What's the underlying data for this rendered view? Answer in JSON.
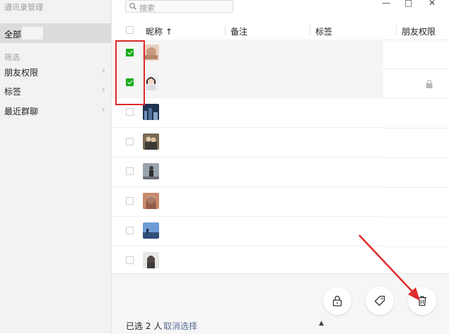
{
  "app": {
    "title": "通讯录管理"
  },
  "sidebar": {
    "all_label": "全部",
    "filter_label": "筛选",
    "items": [
      {
        "label": "朋友权限"
      },
      {
        "label": "标签"
      },
      {
        "label": "最近群聊"
      }
    ]
  },
  "search": {
    "placeholder": "搜索"
  },
  "table": {
    "columns": [
      {
        "label": "昵称 ↑"
      },
      {
        "label": "备注"
      },
      {
        "label": "标签"
      },
      {
        "label": "朋友权限"
      }
    ],
    "rows": [
      {
        "checked": true,
        "avatar": "avatar-food",
        "name": "",
        "remark": "",
        "tag": "",
        "permission": ""
      },
      {
        "checked": true,
        "avatar": "avatar-woman",
        "name": "",
        "remark": "",
        "tag": "",
        "permission": "lock"
      },
      {
        "checked": false,
        "avatar": "avatar-night-city",
        "name": "",
        "remark": "",
        "tag": "",
        "permission": ""
      },
      {
        "checked": false,
        "avatar": "avatar-couple",
        "name": "",
        "remark": "",
        "tag": "",
        "permission": ""
      },
      {
        "checked": false,
        "avatar": "avatar-street",
        "name": "",
        "remark": "",
        "tag": "",
        "permission": ""
      },
      {
        "checked": false,
        "avatar": "avatar-portrait",
        "name": "",
        "remark": "",
        "tag": "",
        "permission": ""
      },
      {
        "checked": false,
        "avatar": "avatar-sky",
        "name": "",
        "remark": "",
        "tag": "",
        "permission": ""
      },
      {
        "checked": false,
        "avatar": "avatar-girl",
        "name": "",
        "remark": "",
        "tag": "",
        "permission": ""
      }
    ]
  },
  "footer": {
    "selected_prefix": "已选",
    "selected_count": "2",
    "selected_suffix": "人",
    "cancel_label": "取消选择",
    "buttons": [
      {
        "icon": "lock-icon"
      },
      {
        "icon": "tag-icon"
      },
      {
        "icon": "trash-icon"
      }
    ]
  },
  "colors": {
    "accent_green": "#1aad19",
    "annotation_red": "#e02b2b",
    "link": "#576b95"
  }
}
